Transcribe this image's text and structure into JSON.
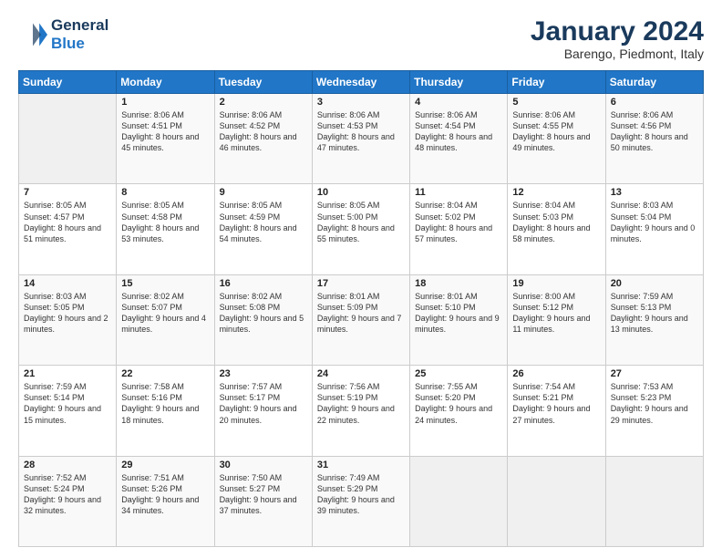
{
  "logo": {
    "line1": "General",
    "line2": "Blue"
  },
  "header": {
    "title": "January 2024",
    "subtitle": "Barengo, Piedmont, Italy"
  },
  "weekdays": [
    "Sunday",
    "Monday",
    "Tuesday",
    "Wednesday",
    "Thursday",
    "Friday",
    "Saturday"
  ],
  "weeks": [
    [
      {
        "day": "",
        "sunrise": "",
        "sunset": "",
        "daylight": ""
      },
      {
        "day": "1",
        "sunrise": "Sunrise: 8:06 AM",
        "sunset": "Sunset: 4:51 PM",
        "daylight": "Daylight: 8 hours and 45 minutes."
      },
      {
        "day": "2",
        "sunrise": "Sunrise: 8:06 AM",
        "sunset": "Sunset: 4:52 PM",
        "daylight": "Daylight: 8 hours and 46 minutes."
      },
      {
        "day": "3",
        "sunrise": "Sunrise: 8:06 AM",
        "sunset": "Sunset: 4:53 PM",
        "daylight": "Daylight: 8 hours and 47 minutes."
      },
      {
        "day": "4",
        "sunrise": "Sunrise: 8:06 AM",
        "sunset": "Sunset: 4:54 PM",
        "daylight": "Daylight: 8 hours and 48 minutes."
      },
      {
        "day": "5",
        "sunrise": "Sunrise: 8:06 AM",
        "sunset": "Sunset: 4:55 PM",
        "daylight": "Daylight: 8 hours and 49 minutes."
      },
      {
        "day": "6",
        "sunrise": "Sunrise: 8:06 AM",
        "sunset": "Sunset: 4:56 PM",
        "daylight": "Daylight: 8 hours and 50 minutes."
      }
    ],
    [
      {
        "day": "7",
        "sunrise": "Sunrise: 8:05 AM",
        "sunset": "Sunset: 4:57 PM",
        "daylight": "Daylight: 8 hours and 51 minutes."
      },
      {
        "day": "8",
        "sunrise": "Sunrise: 8:05 AM",
        "sunset": "Sunset: 4:58 PM",
        "daylight": "Daylight: 8 hours and 53 minutes."
      },
      {
        "day": "9",
        "sunrise": "Sunrise: 8:05 AM",
        "sunset": "Sunset: 4:59 PM",
        "daylight": "Daylight: 8 hours and 54 minutes."
      },
      {
        "day": "10",
        "sunrise": "Sunrise: 8:05 AM",
        "sunset": "Sunset: 5:00 PM",
        "daylight": "Daylight: 8 hours and 55 minutes."
      },
      {
        "day": "11",
        "sunrise": "Sunrise: 8:04 AM",
        "sunset": "Sunset: 5:02 PM",
        "daylight": "Daylight: 8 hours and 57 minutes."
      },
      {
        "day": "12",
        "sunrise": "Sunrise: 8:04 AM",
        "sunset": "Sunset: 5:03 PM",
        "daylight": "Daylight: 8 hours and 58 minutes."
      },
      {
        "day": "13",
        "sunrise": "Sunrise: 8:03 AM",
        "sunset": "Sunset: 5:04 PM",
        "daylight": "Daylight: 9 hours and 0 minutes."
      }
    ],
    [
      {
        "day": "14",
        "sunrise": "Sunrise: 8:03 AM",
        "sunset": "Sunset: 5:05 PM",
        "daylight": "Daylight: 9 hours and 2 minutes."
      },
      {
        "day": "15",
        "sunrise": "Sunrise: 8:02 AM",
        "sunset": "Sunset: 5:07 PM",
        "daylight": "Daylight: 9 hours and 4 minutes."
      },
      {
        "day": "16",
        "sunrise": "Sunrise: 8:02 AM",
        "sunset": "Sunset: 5:08 PM",
        "daylight": "Daylight: 9 hours and 5 minutes."
      },
      {
        "day": "17",
        "sunrise": "Sunrise: 8:01 AM",
        "sunset": "Sunset: 5:09 PM",
        "daylight": "Daylight: 9 hours and 7 minutes."
      },
      {
        "day": "18",
        "sunrise": "Sunrise: 8:01 AM",
        "sunset": "Sunset: 5:10 PM",
        "daylight": "Daylight: 9 hours and 9 minutes."
      },
      {
        "day": "19",
        "sunrise": "Sunrise: 8:00 AM",
        "sunset": "Sunset: 5:12 PM",
        "daylight": "Daylight: 9 hours and 11 minutes."
      },
      {
        "day": "20",
        "sunrise": "Sunrise: 7:59 AM",
        "sunset": "Sunset: 5:13 PM",
        "daylight": "Daylight: 9 hours and 13 minutes."
      }
    ],
    [
      {
        "day": "21",
        "sunrise": "Sunrise: 7:59 AM",
        "sunset": "Sunset: 5:14 PM",
        "daylight": "Daylight: 9 hours and 15 minutes."
      },
      {
        "day": "22",
        "sunrise": "Sunrise: 7:58 AM",
        "sunset": "Sunset: 5:16 PM",
        "daylight": "Daylight: 9 hours and 18 minutes."
      },
      {
        "day": "23",
        "sunrise": "Sunrise: 7:57 AM",
        "sunset": "Sunset: 5:17 PM",
        "daylight": "Daylight: 9 hours and 20 minutes."
      },
      {
        "day": "24",
        "sunrise": "Sunrise: 7:56 AM",
        "sunset": "Sunset: 5:19 PM",
        "daylight": "Daylight: 9 hours and 22 minutes."
      },
      {
        "day": "25",
        "sunrise": "Sunrise: 7:55 AM",
        "sunset": "Sunset: 5:20 PM",
        "daylight": "Daylight: 9 hours and 24 minutes."
      },
      {
        "day": "26",
        "sunrise": "Sunrise: 7:54 AM",
        "sunset": "Sunset: 5:21 PM",
        "daylight": "Daylight: 9 hours and 27 minutes."
      },
      {
        "day": "27",
        "sunrise": "Sunrise: 7:53 AM",
        "sunset": "Sunset: 5:23 PM",
        "daylight": "Daylight: 9 hours and 29 minutes."
      }
    ],
    [
      {
        "day": "28",
        "sunrise": "Sunrise: 7:52 AM",
        "sunset": "Sunset: 5:24 PM",
        "daylight": "Daylight: 9 hours and 32 minutes."
      },
      {
        "day": "29",
        "sunrise": "Sunrise: 7:51 AM",
        "sunset": "Sunset: 5:26 PM",
        "daylight": "Daylight: 9 hours and 34 minutes."
      },
      {
        "day": "30",
        "sunrise": "Sunrise: 7:50 AM",
        "sunset": "Sunset: 5:27 PM",
        "daylight": "Daylight: 9 hours and 37 minutes."
      },
      {
        "day": "31",
        "sunrise": "Sunrise: 7:49 AM",
        "sunset": "Sunset: 5:29 PM",
        "daylight": "Daylight: 9 hours and 39 minutes."
      },
      {
        "day": "",
        "sunrise": "",
        "sunset": "",
        "daylight": ""
      },
      {
        "day": "",
        "sunrise": "",
        "sunset": "",
        "daylight": ""
      },
      {
        "day": "",
        "sunrise": "",
        "sunset": "",
        "daylight": ""
      }
    ]
  ]
}
